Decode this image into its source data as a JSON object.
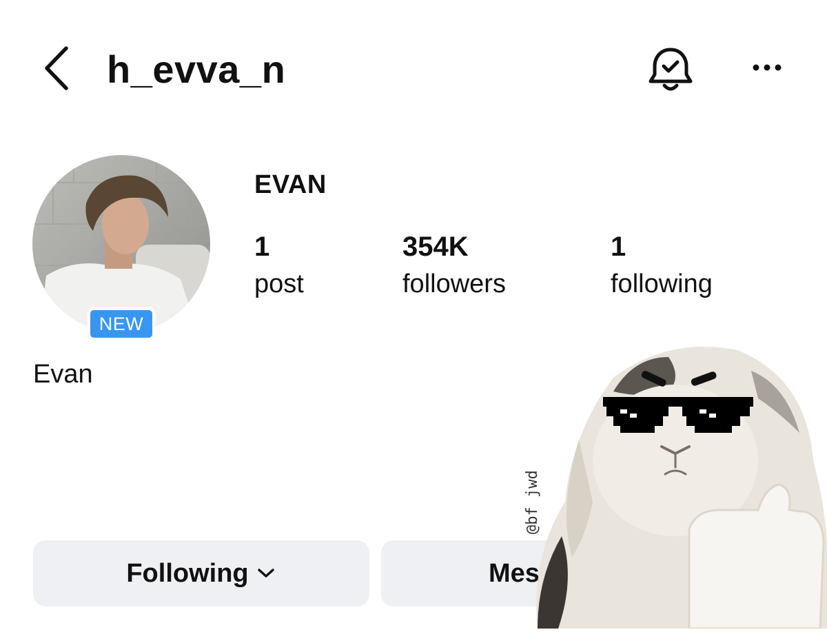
{
  "header": {
    "username": "h_evva_n"
  },
  "profile": {
    "display_name": "EVAN",
    "badge": "NEW",
    "bio_name": "Evan"
  },
  "stats": {
    "posts_count": "1",
    "posts_label": "post",
    "followers_count": "354K",
    "followers_label": "followers",
    "following_count": "1",
    "following_label": "following"
  },
  "actions": {
    "following_label": "Following",
    "message_label": "Message"
  },
  "overlay": {
    "watermark": "@bf jwd"
  },
  "colors": {
    "badge": "#3797f0",
    "button_bg": "#eff0f3",
    "text": "#111111"
  }
}
